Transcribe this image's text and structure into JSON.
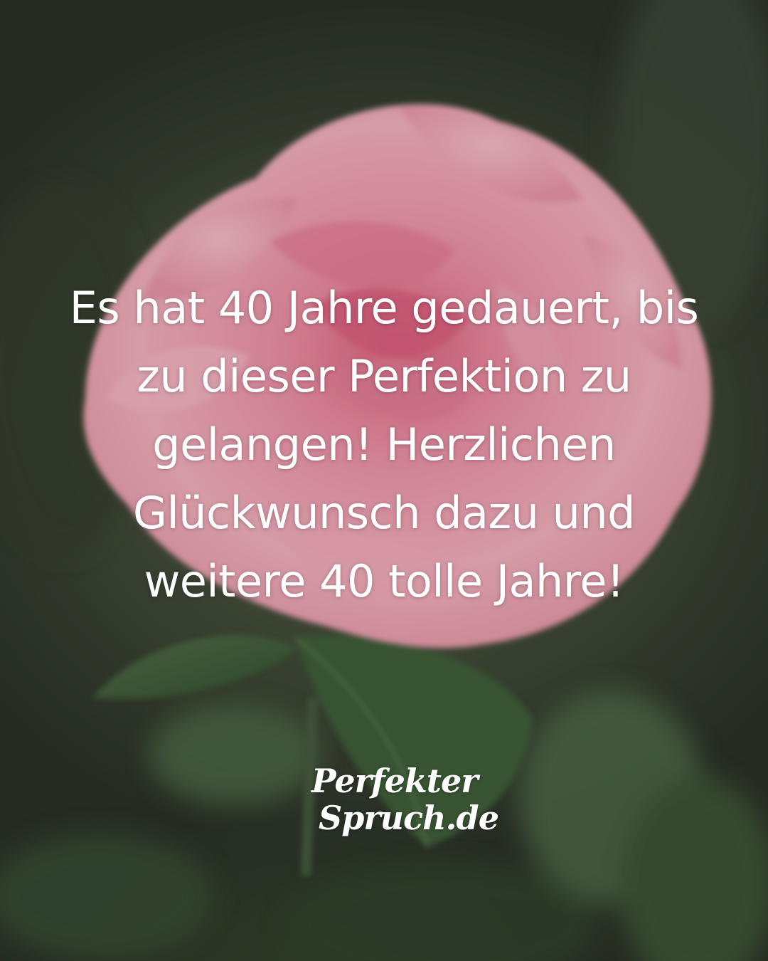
{
  "quote": {
    "lines": [
      "Es hat 40 Jahre gedauert, bis",
      "zu dieser Perfektion zu",
      "gelangen! Herzlichen",
      "Glückwunsch dazu und",
      "weitere 40 tolle Jahre!"
    ]
  },
  "logo": {
    "line1": "Perfekter",
    "line2": "Spruch.de"
  },
  "background": {
    "subject": "pink rose with green leaves",
    "rose_color": "#e79aa9",
    "leaf_color": "#3f5a3a"
  }
}
